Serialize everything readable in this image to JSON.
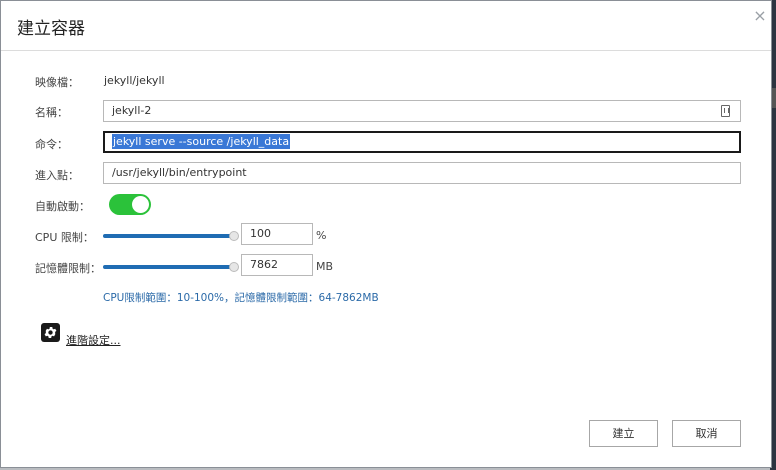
{
  "dialog": {
    "title": "建立容器",
    "close_glyph": "×"
  },
  "fields": {
    "image_label": "映像檔：",
    "image_value": "jekyll/jekyll",
    "name_label": "名稱：",
    "name_value": "jekyll-2",
    "command_label": "命令：",
    "command_value": "jekyll serve --source /jekyll_data",
    "entrypoint_label": "進入點：",
    "entrypoint_value": "/usr/jekyll/bin/entrypoint",
    "autostart_label": "自動啟動：",
    "autostart_on": true,
    "cpu_label": "CPU 限制：",
    "cpu_value": "100",
    "cpu_unit": "%",
    "cpu_level": 1.0,
    "memory_label": "記憶體限制：",
    "memory_value": "7862",
    "memory_unit": "MB",
    "memory_level": 1.0,
    "range_info": "CPU限制範圍：10-100%，記憶體限制範圍：64-7862MB"
  },
  "advanced": {
    "icon": "gear-icon",
    "label": "進階設定..."
  },
  "buttons": {
    "create": "建立",
    "cancel": "取消"
  },
  "colors": {
    "toggle_on": "#2bc23a",
    "slider": "#1f6cb3",
    "selection": "#3a78d6",
    "info_text": "#2b6aa8"
  }
}
